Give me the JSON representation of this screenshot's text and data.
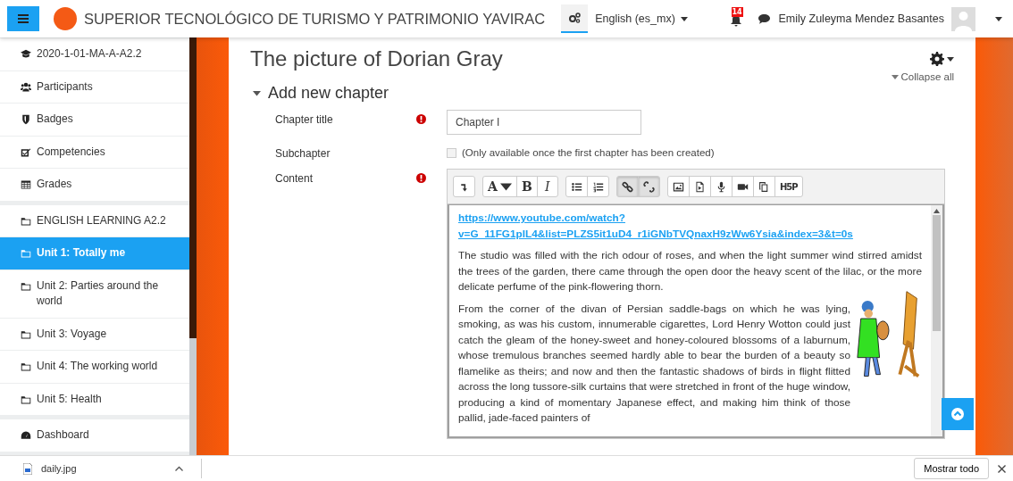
{
  "header": {
    "site_name": "SUPERIOR TECNOLÓGICO DE TURISMO Y PATRIMONIO YAVIRAC",
    "settings_active": true,
    "language": "English (es_mx)",
    "notification_count": "14",
    "user_name": "Emily Zuleyma Mendez Basantes"
  },
  "sidebar": {
    "groups": [
      {
        "items": [
          {
            "kind": "course",
            "label": "2020-1-01-MA-A-A2.2",
            "selected": false
          },
          {
            "kind": "participants",
            "label": "Participants",
            "selected": false
          },
          {
            "kind": "badge",
            "label": "Badges",
            "selected": false
          },
          {
            "kind": "competencies",
            "label": "Competencies",
            "selected": false
          },
          {
            "kind": "grades",
            "label": "Grades",
            "selected": false
          }
        ]
      },
      {
        "items": [
          {
            "kind": "folder",
            "label": "ENGLISH LEARNING A2.2",
            "selected": false
          },
          {
            "kind": "folder",
            "label": "Unit 1: Totally me",
            "selected": true
          },
          {
            "kind": "folder",
            "label": "Unit 2: Parties around the world",
            "selected": false
          },
          {
            "kind": "folder",
            "label": "Unit 3: Voyage",
            "selected": false
          },
          {
            "kind": "folder",
            "label": "Unit 4: The working world",
            "selected": false
          },
          {
            "kind": "folder",
            "label": "Unit 5: Health",
            "selected": false
          }
        ]
      },
      {
        "items": [
          {
            "kind": "dashboard",
            "label": "Dashboard",
            "selected": false
          }
        ]
      }
    ]
  },
  "main": {
    "title": "The picture of Dorian Gray",
    "collapse_all": "Collapse all",
    "section": {
      "title": "Add new chapter",
      "expanded": true
    },
    "fields": [
      {
        "kind": "text",
        "label": "Chapter title",
        "required": true,
        "value": "Chapter I"
      },
      {
        "kind": "checkbox",
        "label": "Subchapter",
        "required": false,
        "checked": false,
        "disabled": true,
        "text": "(Only available once the first chapter has been created)"
      },
      {
        "kind": "editor",
        "label": "Content",
        "required": true
      }
    ],
    "editor": {
      "toolbar": [
        [
          {
            "kind": "collapse",
            "pressed": false
          }
        ],
        [
          {
            "kind": "font",
            "label": "A",
            "pressed": false
          },
          {
            "kind": "bold",
            "label": "B",
            "pressed": false
          },
          {
            "kind": "italic",
            "label": "I",
            "pressed": false
          }
        ],
        [
          {
            "kind": "bullets",
            "pressed": false
          },
          {
            "kind": "numbers",
            "pressed": false
          }
        ],
        [
          {
            "kind": "link",
            "pressed": true
          },
          {
            "kind": "unlink",
            "pressed": true
          }
        ],
        [
          {
            "kind": "image",
            "pressed": false
          },
          {
            "kind": "media",
            "pressed": false
          },
          {
            "kind": "microphone",
            "pressed": false
          },
          {
            "kind": "video",
            "pressed": false
          },
          {
            "kind": "copy",
            "pressed": false
          },
          {
            "kind": "h5p",
            "label": "H5P",
            "pressed": false
          }
        ]
      ],
      "link": "https://www.youtube.com/watch?v=G_11FG1pIL4&list=PLZS5it1uD4_r1iGNbTVQnaxH9zWw6Ysia&index=3&t=0s",
      "paragraphs": [
        "The studio was filled with the rich odour of roses, and when the light summer wind stirred amidst the trees of the garden, there came through the open door the heavy scent of the lilac, or the more delicate perfume of the pink-flowering thorn.",
        "From the corner of the divan of Persian saddle-bags on which he was lying, smoking, as was his custom, innumerable cigarettes, Lord Henry Wotton could just catch the gleam of the honey-sweet and honey-coloured blossoms of a laburnum, whose tremulous branches seemed hardly able to bear the burden of a beauty so flamelike as theirs; and now and then the fantastic shadows of birds in flight flitted across the long tussore-silk curtains that were stretched in front of the huge window, producing a kind of momentary Japanese effect, and making him think of those pallid, jade-faced painters of"
      ]
    }
  },
  "download_bar": {
    "file": "daily.jpg",
    "show_all": "Mostrar todo"
  }
}
